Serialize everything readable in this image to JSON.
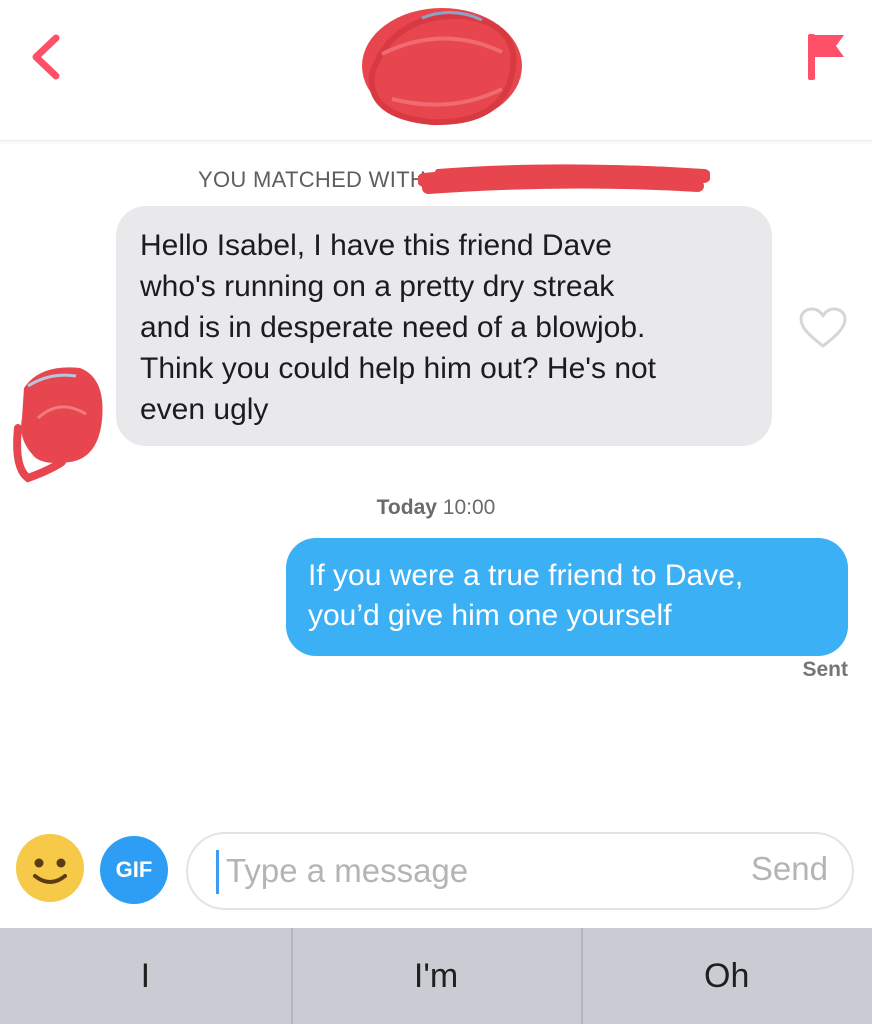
{
  "header": {
    "back_icon": "chevron-left-icon",
    "flag_icon": "flag-icon",
    "accent_color": "#fe5068"
  },
  "conversation": {
    "match_notice": "YOU MATCHED WITH",
    "incoming_message": "Hello Isabel, I have this friend Dave\nwho's running on a pretty dry streak\nand is in desperate need of a blowjob.\nThink you could help him out? He's not\neven ugly",
    "timestamp_day": "Today",
    "timestamp_time": "10:00",
    "outgoing_message": "If you were a true friend to Dave,\nyou’d give him one yourself",
    "sent_status": "Sent",
    "incoming_bubble_color": "#e9e9eb",
    "outgoing_bubble_color": "#3cb0f5"
  },
  "composer": {
    "emoji_icon": "smiley-face-icon",
    "gif_label": "GIF",
    "placeholder": "Type a message",
    "send_label": "Send"
  },
  "keyboard": {
    "suggestions": [
      "I",
      "I'm",
      "Oh"
    ]
  }
}
